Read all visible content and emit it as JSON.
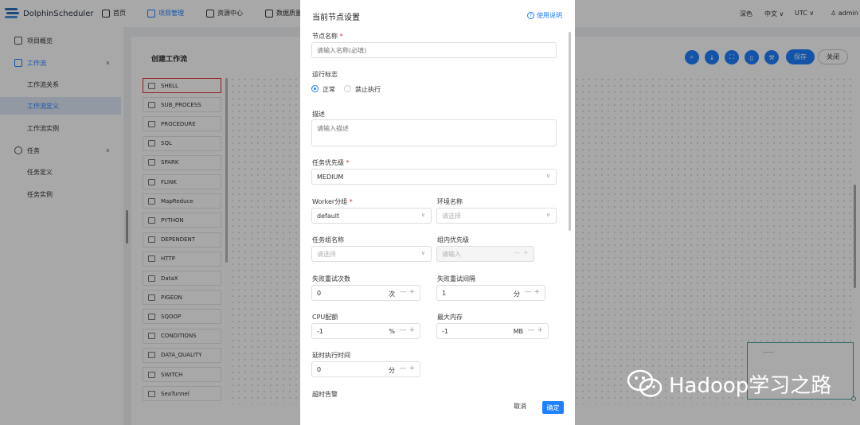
{
  "app": {
    "name": "DolphinScheduler"
  },
  "header": {
    "nav": [
      {
        "label": "首页",
        "icon": "home-icon"
      },
      {
        "label": "项目管理",
        "icon": "project-icon"
      },
      {
        "label": "资源中心",
        "icon": "folder-icon"
      },
      {
        "label": "数据质量",
        "icon": "document-icon"
      }
    ],
    "right": {
      "theme": "深色",
      "language": "中文",
      "timezone": "UTC",
      "user": "admin"
    }
  },
  "sidebar": {
    "items": [
      {
        "label": "项目概览"
      },
      {
        "label": "工作流"
      },
      {
        "label": "工作流关系"
      },
      {
        "label": "工作流定义"
      },
      {
        "label": "工作流实例"
      },
      {
        "label": "任务"
      },
      {
        "label": "任务定义"
      },
      {
        "label": "任务实例"
      }
    ]
  },
  "workflow": {
    "title": "创建工作流",
    "save_label": "保存",
    "close_label": "关闭",
    "tasks": [
      "SHELL",
      "SUB_PROCESS",
      "PROCEDURE",
      "SQL",
      "SPARK",
      "FLINK",
      "MapReduce",
      "PYTHON",
      "DEPENDENT",
      "HTTP",
      "DataX",
      "PIGEON",
      "SQOOP",
      "CONDITIONS",
      "DATA_QUALITY",
      "SWITCH",
      "SeaTunnel"
    ]
  },
  "drawer": {
    "title": "当前节点设置",
    "help": "使用说明",
    "node_name": {
      "label": "节点名称",
      "placeholder": "请输入名称(必填)"
    },
    "run_flag": {
      "label": "运行标志",
      "opt_normal": "正常",
      "opt_forbid": "禁止执行"
    },
    "desc": {
      "label": "描述",
      "placeholder": "请输入描述"
    },
    "priority": {
      "label": "任务优先级",
      "value": "MEDIUM"
    },
    "worker_group": {
      "label": "Worker分组",
      "value": "default"
    },
    "environment": {
      "label": "环境名称",
      "placeholder": "请选择"
    },
    "task_group": {
      "label": "任务组名称",
      "placeholder": "请选择"
    },
    "group_priority": {
      "label": "组内优先级",
      "placeholder": "请输入"
    },
    "retry_times": {
      "label": "失败重试次数",
      "value": "0",
      "unit": "次"
    },
    "retry_interval": {
      "label": "失败重试间隔",
      "value": "1",
      "unit": "分"
    },
    "cpu_quota": {
      "label": "CPU配额",
      "value": "-1",
      "unit": "%"
    },
    "max_memory": {
      "label": "最大内存",
      "value": "-1",
      "unit": "MB"
    },
    "delay_time": {
      "label": "延时执行时间",
      "value": "0",
      "unit": "分"
    },
    "timeout_alarm": {
      "label": "超时告警"
    },
    "cancel_label": "取消",
    "ok_label": "确定"
  },
  "watermark": "Hadoop学习之路"
}
